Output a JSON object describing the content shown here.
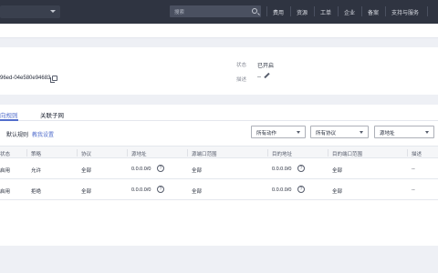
{
  "topbar": {
    "search_placeholder": "搜索",
    "nav": [
      "费用",
      "资源",
      "工单",
      "企业",
      "备案",
      "支持与服务"
    ]
  },
  "detail": {
    "id_text": "96ed-04e580e94683",
    "status_label": "状态",
    "status_value": "已开启",
    "desc_label": "描述",
    "desc_value": "--"
  },
  "tabs": {
    "rules": "向规则",
    "subnets": "关联子网"
  },
  "toolbar": {
    "default_rule": "默认规则",
    "help_link": "教我设置",
    "filter_action": "所有动作",
    "filter_protocol": "所有协议",
    "filter_source": "源地址"
  },
  "table": {
    "headers": [
      "状态",
      "策略",
      "协议",
      "源地址",
      "源端口范围",
      "目的地址",
      "目的端口范围",
      "描述"
    ],
    "rows": [
      {
        "status": "启用",
        "policy": "允许",
        "protocol": "全部",
        "src": "0.0.0.0/0",
        "src_port": "全部",
        "dst": "0.0.0.0/0",
        "dst_port": "全部",
        "desc": "--"
      },
      {
        "status": "启用",
        "policy": "拒绝",
        "protocol": "全部",
        "src": "0.0.0.0/0",
        "src_port": "全部",
        "dst": "0.0.0.0/0",
        "dst_port": "全部",
        "desc": "--"
      }
    ]
  },
  "colors": {
    "nav_bg": "#2f3441",
    "accent": "#526ecc",
    "page_bg": "#eef0f5"
  }
}
